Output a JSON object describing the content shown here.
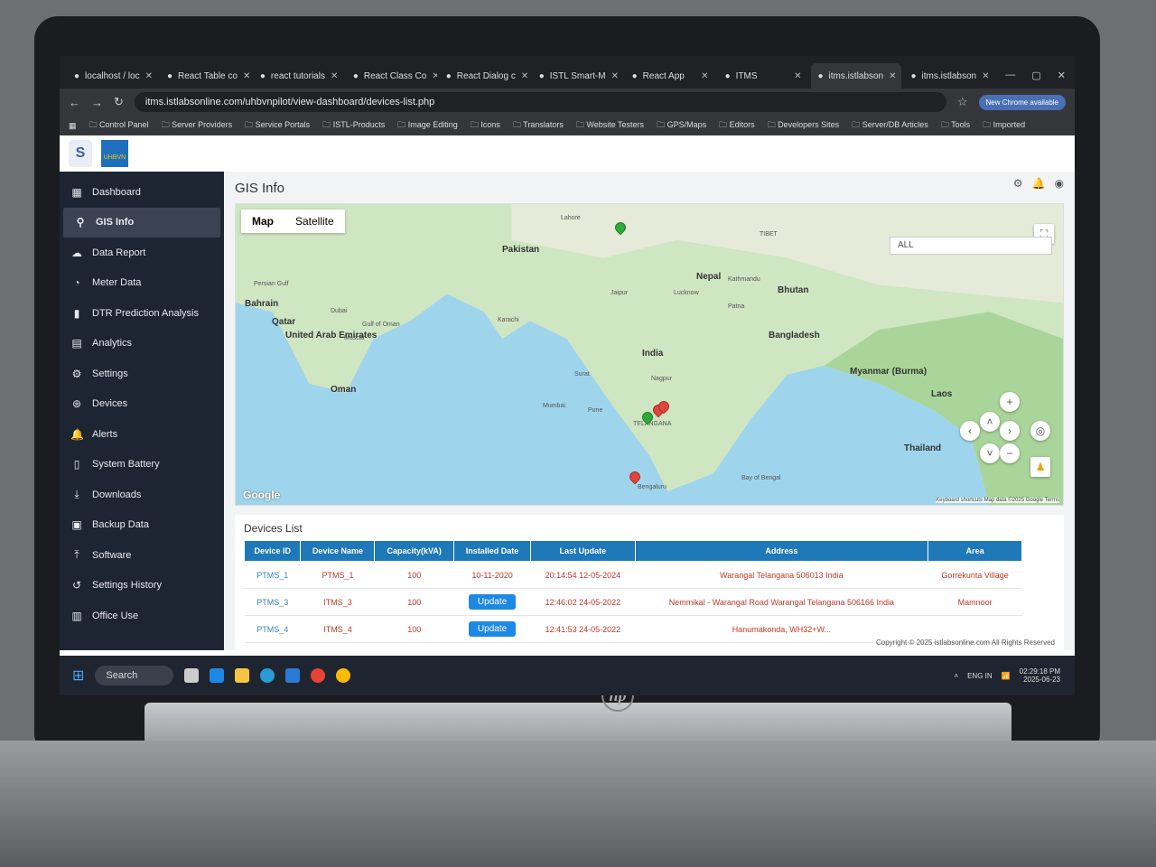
{
  "browser": {
    "tabs": [
      {
        "label": "localhost / loc"
      },
      {
        "label": "React Table co"
      },
      {
        "label": "react tutorials"
      },
      {
        "label": "React Class Co"
      },
      {
        "label": "React Dialog c"
      },
      {
        "label": "ISTL Smart-M"
      },
      {
        "label": "React App"
      },
      {
        "label": "ITMS"
      },
      {
        "label": "itms.istlabson"
      },
      {
        "label": "itms.istlabson"
      }
    ],
    "url": "itms.istlabsonline.com/uhbvnpilot/view-dashboard/devices-list.php",
    "update_badge": "New Chrome available",
    "bookmarks": [
      "Control Panel",
      "Server Providers",
      "Service Portals",
      "ISTL-Products",
      "Image Editing",
      "Icons",
      "Translators",
      "Website Testers",
      "GPS/Maps",
      "Editors",
      "Developers Sites",
      "Server/DB Articles",
      "Tools",
      "Imported"
    ]
  },
  "header": {
    "logo_text": "UHBVN"
  },
  "sidebar": {
    "items": [
      {
        "label": "Dashboard",
        "icon": "dashboard-icon"
      },
      {
        "label": "GIS Info",
        "icon": "location-icon",
        "active": true
      },
      {
        "label": "Data Report",
        "icon": "cloud-icon"
      },
      {
        "label": "Meter Data",
        "icon": "gauge-icon"
      },
      {
        "label": "DTR Prediction Analysis",
        "icon": "bar-chart-icon"
      },
      {
        "label": "Analytics",
        "icon": "analytics-icon"
      },
      {
        "label": "Settings",
        "icon": "gear-icon"
      },
      {
        "label": "Devices",
        "icon": "device-icon"
      },
      {
        "label": "Alerts",
        "icon": "bell-icon"
      },
      {
        "label": "System Battery",
        "icon": "battery-icon"
      },
      {
        "label": "Downloads",
        "icon": "download-icon"
      },
      {
        "label": "Backup Data",
        "icon": "backup-icon"
      },
      {
        "label": "Software",
        "icon": "upload-icon"
      },
      {
        "label": "Settings History",
        "icon": "history-icon"
      },
      {
        "label": "Office Use",
        "icon": "building-icon"
      }
    ]
  },
  "page": {
    "title": "GIS Info"
  },
  "map": {
    "types": [
      "Map",
      "Satellite"
    ],
    "filter": "ALL",
    "labels": {
      "pakistan": "Pakistan",
      "india": "India",
      "nepal": "Nepal",
      "bhutan": "Bhutan",
      "bangladesh": "Bangladesh",
      "myanmar": "Myanmar (Burma)",
      "thailand": "Thailand",
      "laos": "Laos",
      "oman": "Oman",
      "uae": "United Arab Emirates",
      "qatar": "Qatar",
      "bahrain": "Bahrain",
      "muscat": "Muscat",
      "dubai": "Dubai",
      "karachi": "Karachi",
      "mumbai": "Mumbai",
      "pune": "Pune",
      "surat": "Surat",
      "nagpur": "Nagpur",
      "jaipur": "Jaipur",
      "lucknow": "Lucknow",
      "patna": "Patna",
      "kathmandu": "Kathmandu",
      "lahore": "Lahore",
      "bengaluru": "Bengaluru",
      "telangana": "TELANGANA",
      "bay": "Bay of Bengal",
      "tibet": "TIBET",
      "persian": "Persian Gulf",
      "gulf_oman": "Gulf of Oman"
    },
    "google": "Google",
    "footer": "Keyboard shortcuts   Map data ©2025 Google   Terms",
    "markers": [
      {
        "color": "#2eaa3a"
      },
      {
        "color": "#2eaa3a"
      },
      {
        "color": "#e0453a"
      },
      {
        "color": "#e0453a"
      },
      {
        "color": "#e0453a"
      }
    ]
  },
  "devices": {
    "title": "Devices List",
    "columns": [
      "Device ID",
      "Device Name",
      "Capacity(kVA)",
      "Installed Date",
      "Last Update",
      "Address",
      "Area"
    ],
    "rows": [
      {
        "id": "PTMS_1",
        "name": "PTMS_1",
        "capacity": "100",
        "installed": "10-11-2020",
        "last": "20:14:54 12-05-2024",
        "address": "Warangal Telangana 506013 India",
        "area": "Gorrekunta Village"
      },
      {
        "id": "PTMS_3",
        "name": "ITMS_3",
        "capacity": "100",
        "installed": "Update",
        "last": "12:46:02 24-05-2022",
        "address": "Nemmikal - Warangal Road Warangal Telangana 506166 India",
        "area": "Mamnoor"
      },
      {
        "id": "PTMS_4",
        "name": "ITMS_4",
        "capacity": "100",
        "installed": "Update",
        "last": "12:41:53 24-05-2022",
        "address": "Hanumakonda, WH32+W...",
        "area": ""
      }
    ],
    "copyright": "Copyright © 2025 istlabsonline.com All Rights Reserved"
  },
  "taskbar": {
    "search": "Search",
    "lang": "ENG IN",
    "time": "02:29:18 PM",
    "date": "2025-06-23"
  }
}
